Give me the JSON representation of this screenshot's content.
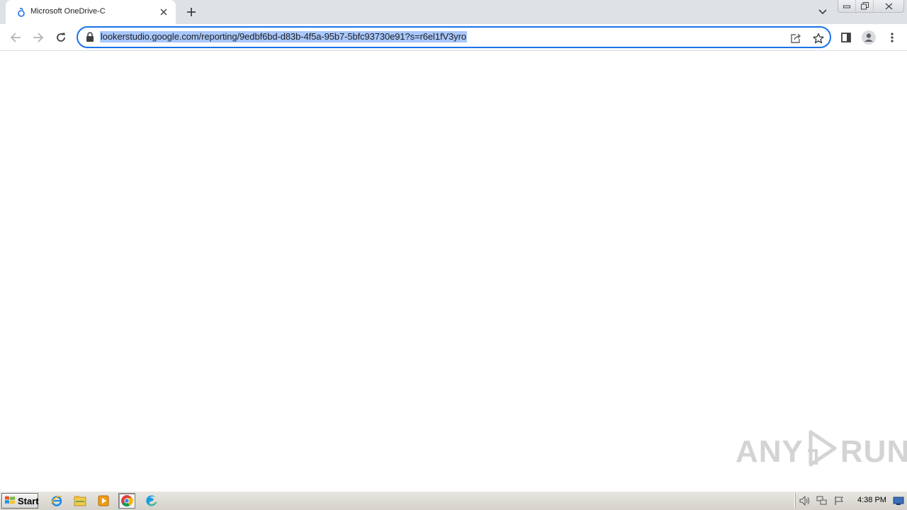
{
  "browser": {
    "tab": {
      "title": "Microsoft OneDrive-C",
      "favicon": "loading-spinner-icon"
    },
    "address_bar": {
      "url": "lookerstudio.google.com/reporting/9edbf6bd-d83b-4f5a-95b7-5bfc93730e91?s=r6el1fV3yro",
      "selected": true
    },
    "colors": {
      "accent": "#1a73e8",
      "selection": "#a8c7fa",
      "tabstrip": "#dee1e6"
    }
  },
  "watermark": {
    "left": "ANY",
    "right": "RUN"
  },
  "taskbar": {
    "start_label": "Start",
    "pinned": [
      "internet-explorer-icon",
      "file-explorer-icon",
      "media-player-icon",
      "chrome-icon",
      "edge-icon"
    ],
    "clock": "4:38 PM"
  }
}
